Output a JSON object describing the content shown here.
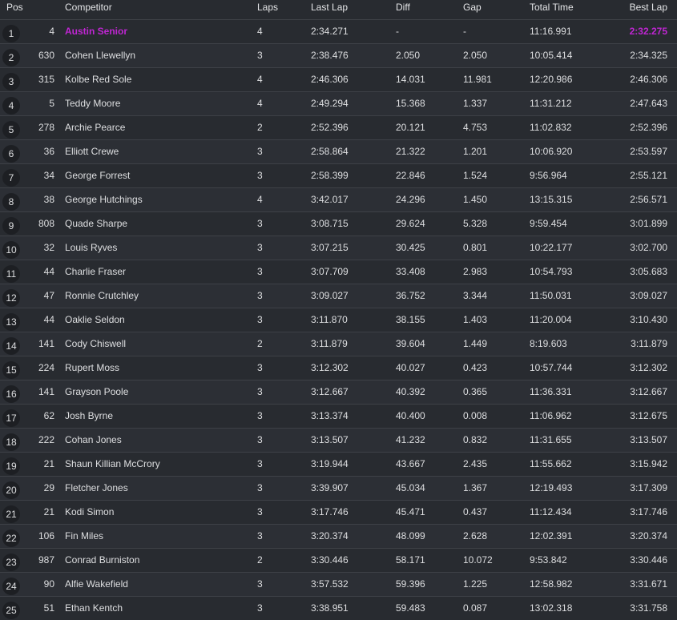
{
  "columns": {
    "pos": "Pos",
    "competitor": "Competitor",
    "laps": "Laps",
    "last_lap": "Last Lap",
    "diff": "Diff",
    "gap": "Gap",
    "total_time": "Total Time",
    "best_lap": "Best Lap"
  },
  "highlight_color": "#c026d3",
  "rows": [
    {
      "pos": "1",
      "number": "4",
      "name": "Austin Senior",
      "laps": "4",
      "last": "2:34.271",
      "diff": "-",
      "gap": "-",
      "total": "11:16.991",
      "best": "2:32.275"
    },
    {
      "pos": "2",
      "number": "630",
      "name": "Cohen Llewellyn",
      "laps": "3",
      "last": "2:38.476",
      "diff": "2.050",
      "gap": "2.050",
      "total": "10:05.414",
      "best": "2:34.325"
    },
    {
      "pos": "3",
      "number": "315",
      "name": "Kolbe Red Sole",
      "laps": "4",
      "last": "2:46.306",
      "diff": "14.031",
      "gap": "11.981",
      "total": "12:20.986",
      "best": "2:46.306"
    },
    {
      "pos": "4",
      "number": "5",
      "name": "Teddy Moore",
      "laps": "4",
      "last": "2:49.294",
      "diff": "15.368",
      "gap": "1.337",
      "total": "11:31.212",
      "best": "2:47.643"
    },
    {
      "pos": "5",
      "number": "278",
      "name": "Archie Pearce",
      "laps": "2",
      "last": "2:52.396",
      "diff": "20.121",
      "gap": "4.753",
      "total": "11:02.832",
      "best": "2:52.396"
    },
    {
      "pos": "6",
      "number": "36",
      "name": "Elliott Crewe",
      "laps": "3",
      "last": "2:58.864",
      "diff": "21.322",
      "gap": "1.201",
      "total": "10:06.920",
      "best": "2:53.597"
    },
    {
      "pos": "7",
      "number": "34",
      "name": "George Forrest",
      "laps": "3",
      "last": "2:58.399",
      "diff": "22.846",
      "gap": "1.524",
      "total": "9:56.964",
      "best": "2:55.121"
    },
    {
      "pos": "8",
      "number": "38",
      "name": "George Hutchings",
      "laps": "4",
      "last": "3:42.017",
      "diff": "24.296",
      "gap": "1.450",
      "total": "13:15.315",
      "best": "2:56.571"
    },
    {
      "pos": "9",
      "number": "808",
      "name": "Quade Sharpe",
      "laps": "3",
      "last": "3:08.715",
      "diff": "29.624",
      "gap": "5.328",
      "total": "9:59.454",
      "best": "3:01.899"
    },
    {
      "pos": "10",
      "number": "32",
      "name": "Louis Ryves",
      "laps": "3",
      "last": "3:07.215",
      "diff": "30.425",
      "gap": "0.801",
      "total": "10:22.177",
      "best": "3:02.700"
    },
    {
      "pos": "11",
      "number": "44",
      "name": "Charlie Fraser",
      "laps": "3",
      "last": "3:07.709",
      "diff": "33.408",
      "gap": "2.983",
      "total": "10:54.793",
      "best": "3:05.683"
    },
    {
      "pos": "12",
      "number": "47",
      "name": "Ronnie Crutchley",
      "laps": "3",
      "last": "3:09.027",
      "diff": "36.752",
      "gap": "3.344",
      "total": "11:50.031",
      "best": "3:09.027"
    },
    {
      "pos": "13",
      "number": "44",
      "name": "Oaklie Seldon",
      "laps": "3",
      "last": "3:11.870",
      "diff": "38.155",
      "gap": "1.403",
      "total": "11:20.004",
      "best": "3:10.430"
    },
    {
      "pos": "14",
      "number": "141",
      "name": "Cody Chiswell",
      "laps": "2",
      "last": "3:11.879",
      "diff": "39.604",
      "gap": "1.449",
      "total": "8:19.603",
      "best": "3:11.879"
    },
    {
      "pos": "15",
      "number": "224",
      "name": "Rupert Moss",
      "laps": "3",
      "last": "3:12.302",
      "diff": "40.027",
      "gap": "0.423",
      "total": "10:57.744",
      "best": "3:12.302"
    },
    {
      "pos": "16",
      "number": "141",
      "name": "Grayson Poole",
      "laps": "3",
      "last": "3:12.667",
      "diff": "40.392",
      "gap": "0.365",
      "total": "11:36.331",
      "best": "3:12.667"
    },
    {
      "pos": "17",
      "number": "62",
      "name": "Josh Byrne",
      "laps": "3",
      "last": "3:13.374",
      "diff": "40.400",
      "gap": "0.008",
      "total": "11:06.962",
      "best": "3:12.675"
    },
    {
      "pos": "18",
      "number": "222",
      "name": "Cohan Jones",
      "laps": "3",
      "last": "3:13.507",
      "diff": "41.232",
      "gap": "0.832",
      "total": "11:31.655",
      "best": "3:13.507"
    },
    {
      "pos": "19",
      "number": "21",
      "name": "Shaun Killian McCrory",
      "laps": "3",
      "last": "3:19.944",
      "diff": "43.667",
      "gap": "2.435",
      "total": "11:55.662",
      "best": "3:15.942"
    },
    {
      "pos": "20",
      "number": "29",
      "name": "Fletcher Jones",
      "laps": "3",
      "last": "3:39.907",
      "diff": "45.034",
      "gap": "1.367",
      "total": "12:19.493",
      "best": "3:17.309"
    },
    {
      "pos": "21",
      "number": "21",
      "name": "Kodi Simon",
      "laps": "3",
      "last": "3:17.746",
      "diff": "45.471",
      "gap": "0.437",
      "total": "11:12.434",
      "best": "3:17.746"
    },
    {
      "pos": "22",
      "number": "106",
      "name": "Fin Miles",
      "laps": "3",
      "last": "3:20.374",
      "diff": "48.099",
      "gap": "2.628",
      "total": "12:02.391",
      "best": "3:20.374"
    },
    {
      "pos": "23",
      "number": "987",
      "name": "Conrad Burniston",
      "laps": "2",
      "last": "3:30.446",
      "diff": "58.171",
      "gap": "10.072",
      "total": "9:53.842",
      "best": "3:30.446"
    },
    {
      "pos": "24",
      "number": "90",
      "name": "Alfie Wakefield",
      "laps": "3",
      "last": "3:57.532",
      "diff": "59.396",
      "gap": "1.225",
      "total": "12:58.982",
      "best": "3:31.671"
    },
    {
      "pos": "25",
      "number": "51",
      "name": "Ethan Kentch",
      "laps": "3",
      "last": "3:38.951",
      "diff": "59.483",
      "gap": "0.087",
      "total": "13:02.318",
      "best": "3:31.758"
    }
  ]
}
